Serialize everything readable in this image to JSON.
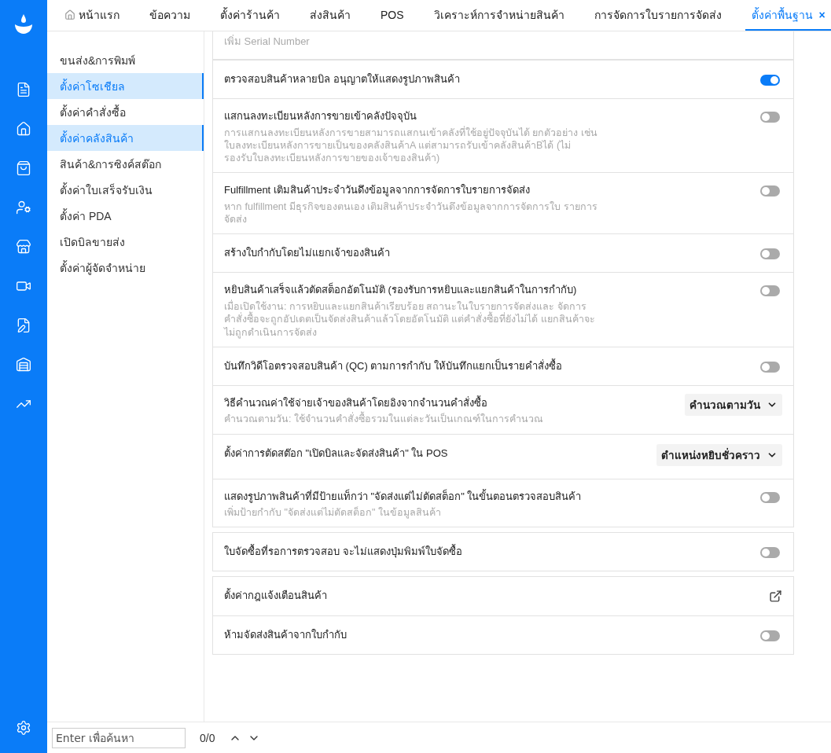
{
  "rail": {
    "items": [
      {
        "selected": false
      },
      {
        "selected": false
      },
      {
        "selected": false
      },
      {
        "selected": false
      },
      {
        "selected": false
      },
      {
        "selected": false
      },
      {
        "selected": false
      },
      {
        "selected": false
      },
      {
        "selected": false
      }
    ]
  },
  "tabs": [
    {
      "label": "หน้าแรก",
      "kind": "home",
      "selected": false
    },
    {
      "label": "ข้อความ",
      "kind": "plain",
      "selected": false
    },
    {
      "label": "ตั้งค่าร้านค้า",
      "kind": "plain",
      "selected": false
    },
    {
      "label": "ส่งสินค้า",
      "kind": "plain",
      "selected": false
    },
    {
      "label": "POS",
      "kind": "plain",
      "selected": false
    },
    {
      "label": "วิเคราะห์การจำหน่ายสินค้า",
      "kind": "plain",
      "selected": false
    },
    {
      "label": "การจัดการใบรายการจัดส่ง",
      "kind": "plain",
      "selected": false
    },
    {
      "label": "ตั้งค่าพื้นฐาน",
      "kind": "closable",
      "close": "×",
      "selected": true
    }
  ],
  "sidebar": {
    "items": [
      {
        "label": "ขนส่ง&การพิมพ์",
        "selected": false
      },
      {
        "label": "ตั้งค่าโซเชียล",
        "selected": true
      },
      {
        "label": "ตั้งค่าคำสั่งซื้อ",
        "selected": false
      },
      {
        "label": "ตั้งค่าคลังสินค้า",
        "selected": true
      },
      {
        "label": "สินค้า&การซิงค์สต๊อก",
        "selected": false
      },
      {
        "label": "ตั้งค่าใบเสร็จรับเงิน",
        "selected": false
      },
      {
        "label": "ตั้งค่า PDA",
        "selected": false
      },
      {
        "label": "เปิดบิลขายส่ง",
        "selected": false
      },
      {
        "label": "ตั้งค่าผู้จัดจำหน่าย",
        "selected": false
      }
    ]
  },
  "cut_text": "เพิ่ม Serial Number",
  "cards": [
    {
      "rows": [
        {
          "kind": "toggle",
          "title": "ตรวจสอบสินค้าหลายบิล อนุญาตให้แสดงรูปภาพสินค้า",
          "on": true
        },
        {
          "kind": "toggle",
          "title": "แสกนลงทะเบียนหลังการขายเข้าคลังปัจจุบัน",
          "description": "การแสกนลงทะเบียนหลังการขายสามารถแสกนเข้าคลังที่ใช้อยู่ปัจจุบันได้ ยกตัวอย่าง เช่น ใบลงทะเบียนหลังการขายเป็นของคลังสินค้าA แต่สามารถรับเข้าคลังสินค้าBได้ (ไม่รองรับใบลงทะเบียนหลังการขายของเจ้าของสินค้า)",
          "on": false
        },
        {
          "kind": "toggle",
          "title": "Fulfillment เติมสินค้าประจำวันดึงข้อมูลจากการจัดการใบรายการจัดส่ง",
          "description": "หาก fulfillment มีธุรกิจของตนเอง เติมสินค้าประจำวันดึงข้อมูลจากการจัดการใบ รายการจัดส่ง",
          "on": false
        },
        {
          "kind": "toggle",
          "title": "สร้างใบกำกับโดยไม่แยกเจ้าของสินค้า",
          "on": false
        },
        {
          "kind": "toggle",
          "title": "หยิบสินค้าเสร็จแล้วตัดสต็อกอัตโนมัติ (รองรับการหยิบและแยกสินค้าในการกำกับ)",
          "description": "เมื่อเปิดใช้งาน: การหยิบและแยกสินค้าเรียบร้อย สถานะในใบรายการจัดส่งและ จัดการคำสั่งซื้อจะถูกอัปเดตเป็นจัดส่งสินค้าแล้วโดยอัตโนมัติ แต่คำสั่งซื้อที่ยังไม่ได้ แยกสินค้าจะไม่ถูกดำเนินการจัดส่ง",
          "on": false
        },
        {
          "kind": "toggle",
          "title": "บันทึกวิดีโอตรวจสอบสินค้า (QC) ตามการกำกับ ให้บันทึกแยกเป็นรายคำสั่งซื้อ",
          "on": false
        },
        {
          "kind": "select",
          "title": "วิธีคำนวณค่าใช้จ่ายเจ้าของสินค้าโดยอิงจากจำนวนคำสั่งซื้อ",
          "description": "คำนวณตามวัน:   ใช้จำนวนคำสั่งซื้อรวมในแต่ละวันเป็นเกณฑ์ในการคำนวณ",
          "value": "คำนวณตามวัน"
        },
        {
          "kind": "select",
          "title": "ตั้งค่าการตัดสต๊อก \"เปิดบิลและจัดส่งสินค้า\" ใน POS",
          "value": "ตำแหน่งหยิบชั่วคราว"
        },
        {
          "kind": "toggle",
          "title": "แสดงรูปภาพสินค้าที่มีป้ายแท็กว่า \"จัดส่งแต่ไม่ตัดสต็อก\" ในขั้นตอนตรวจสอบสินค้า",
          "description": "เพิ่มป้ายกำกับ \"จัดส่งแต่ไม่ตัดสต็อก\" ในข้อมูลสินค้า",
          "on": false
        }
      ]
    },
    {
      "rows": [
        {
          "kind": "toggle",
          "title": "ใบจัดซื้อที่รอการตรวจสอบ จะไม่แสดงปุ่มพิมพ์ใบจัดซื้อ",
          "on": false
        }
      ]
    },
    {
      "rows": [
        {
          "kind": "link",
          "title": "ตั้งค่ากฎแจ้งเตือนสินค้า"
        },
        {
          "kind": "toggle",
          "title": "ห้ามจัดส่งสินค้าจากใบกำกับ",
          "on": false
        }
      ]
    }
  ],
  "findbar": {
    "placeholder": "Enter เพื่อค้นหา",
    "count": "0/0"
  }
}
